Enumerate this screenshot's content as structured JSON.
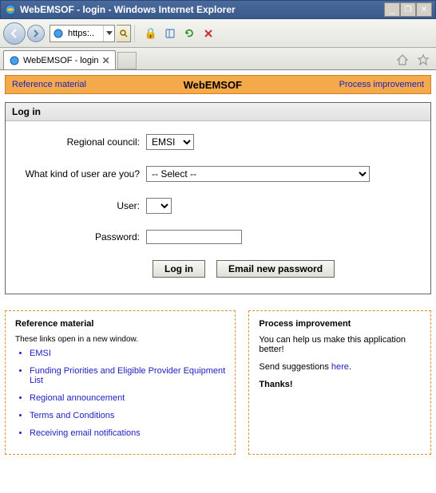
{
  "window": {
    "title": "WebEMSOF - login - Windows Internet Explorer",
    "buttons": {
      "min": "_",
      "max": "❐",
      "close": "✕"
    }
  },
  "addressbar": {
    "url_text": "https:..",
    "lock": "🔒"
  },
  "tab": {
    "label": "WebEMSOF - login"
  },
  "header": {
    "ref_link": "Reference material",
    "title": "WebEMSOF",
    "proc_link": "Process improvement"
  },
  "login": {
    "heading": "Log in",
    "labels": {
      "council": "Regional council:",
      "kind": "What kind of user are you?",
      "user": "User:",
      "password": "Password:"
    },
    "council_value": "EMSI",
    "kind_value": "-- Select --",
    "user_value": "",
    "password_value": "",
    "buttons": {
      "login": "Log in",
      "email_pw": "Email new password"
    }
  },
  "ref_panel": {
    "heading": "Reference material",
    "note": "These links open in a new window.",
    "links": [
      "EMSI",
      "Funding Priorities and Eligible Provider Equipment List",
      "Regional announcement",
      "Terms and Conditions",
      "Receiving email notifications"
    ]
  },
  "proc_panel": {
    "heading": "Process improvement",
    "line1": "You can help us make this application better!",
    "line2a": "Send suggestions ",
    "line2b": "here",
    "line2c": ".",
    "thanks": "Thanks!"
  }
}
